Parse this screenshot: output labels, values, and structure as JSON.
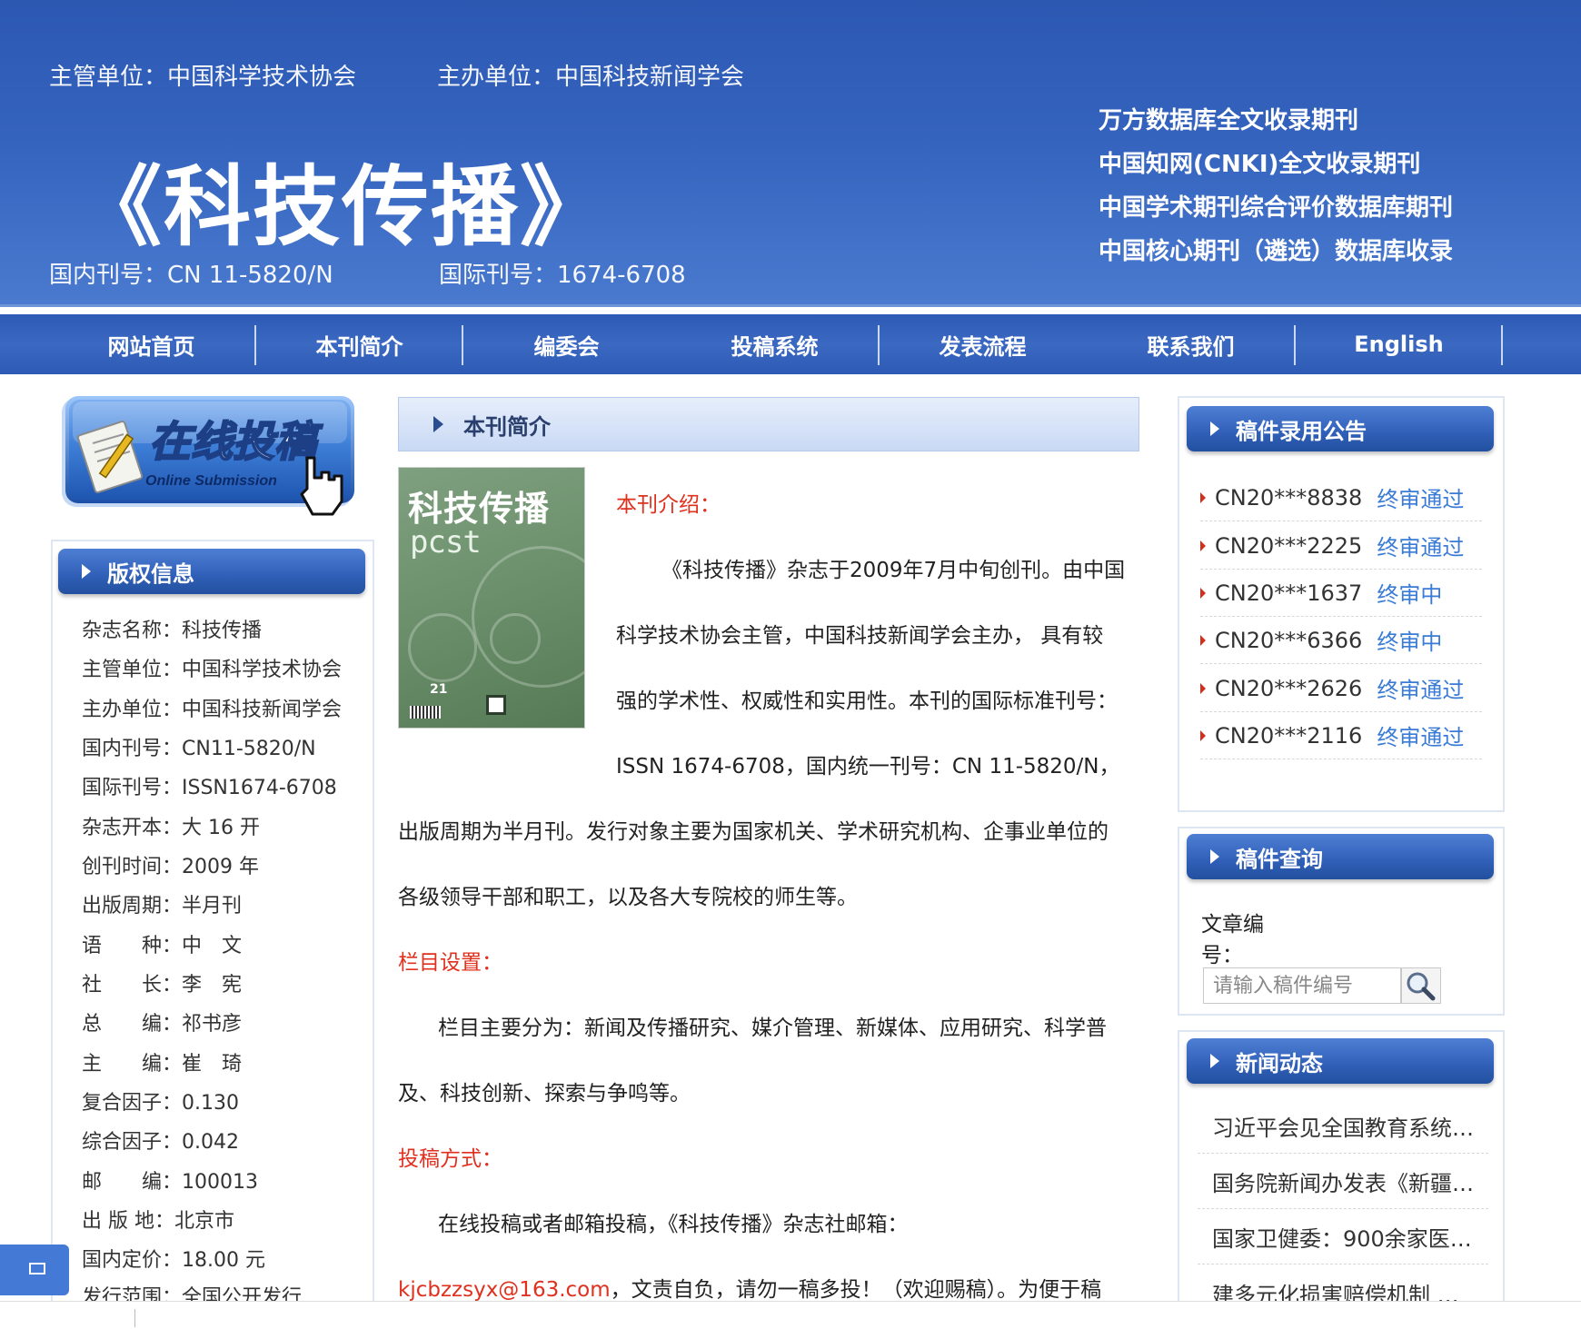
{
  "header": {
    "supervisor": "主管单位：中国科学技术协会",
    "sponsor": "主办单位：中国科技新闻学会",
    "title": "《科技传播》",
    "cn_number": "国内刊号：CN 11-5820/N",
    "issn_number": "国际刊号：1674-6708",
    "indexing": [
      "万方数据库全文收录期刊",
      "中国知网(CNKI)全文收录期刊",
      "中国学术期刊综合评价数据库期刊",
      "中国核心期刊（遴选）数据库收录"
    ]
  },
  "nav": [
    "网站首页",
    "本刊简介",
    "编委会",
    "投稿系统",
    "发表流程",
    "联系我们",
    "English"
  ],
  "submit_banner": {
    "text": "在线投稿",
    "subtext": "Online Submission"
  },
  "copyright": {
    "heading": "版权信息",
    "rows": [
      "杂志名称：科技传播",
      "主管单位：中国科学技术协会",
      "主办单位：中国科技新闻学会",
      "国内刊号：CN11-5820/N",
      "国际刊号：ISSN1674-6708",
      "杂志开本：大 16 开",
      "创刊时间：2009 年",
      "出版周期：半月刊",
      "语　　种：中　文",
      "社　　长：李　宪",
      "总　　编：祁书彦",
      "主　　编：崔　琦",
      "复合因子：0.130",
      "综合因子：0.042",
      "邮　　编：100013",
      "出 版 地：北京市",
      "国内定价：18.00 元",
      "发行范围：全国公开发行"
    ]
  },
  "main": {
    "heading": "本刊简介",
    "cover": {
      "title": "科技传播",
      "subtitle": "pcst",
      "issue": "21"
    },
    "intro_label": "本刊介绍：",
    "intro_lines": [
      "《科技传播》杂志于2009年7月中旬创刊。由中国",
      "科学技术协会主管，中国科技新闻学会主办，  具有较",
      "强的学术性、权威性和实用性。本刊的国际标准刊号：",
      "ISSN 1674-6708，国内统一刊号：CN 11-5820/N，",
      "出版周期为半月刊。发行对象主要为国家机关、学术研究机构、企事业单位的",
      "各级领导干部和职工，以及各大专院校的师生等。"
    ],
    "columns_label": "栏目设置：",
    "columns_lines": [
      "栏目主要分为：新闻及传播研究、媒介管理、新媒体、应用研究、科学普",
      "及、科技创新、探索与争鸣等。"
    ],
    "submission_label": "投稿方式：",
    "submission_line1": "在线投稿或者邮箱投稿，《科技传播》杂志社邮箱：",
    "email": "kjcbzzsyx@163.com",
    "submission_line2_rest": "，文责自负，请勿一稿多投！（欢迎赐稿）。为便于稿"
  },
  "notices": {
    "heading": "稿件录用公告",
    "items": [
      {
        "code": "CN20***8838",
        "status": "终审通过"
      },
      {
        "code": "CN20***2225",
        "status": "终审通过"
      },
      {
        "code": "CN20***1637",
        "status": "终审中"
      },
      {
        "code": "CN20***6366",
        "status": "终审中"
      },
      {
        "code": "CN20***2626",
        "status": "终审通过"
      },
      {
        "code": "CN20***2116",
        "status": "终审通过"
      }
    ]
  },
  "query": {
    "heading": "稿件查询",
    "label_line1": "文章编",
    "label_line2": "号：",
    "placeholder": "请输入稿件编号"
  },
  "news": {
    "heading": "新闻动态",
    "items": [
      "习近平会见全国教育系统…",
      "国务院新闻办发表《新疆…",
      "国家卫健委：900余家医…",
      "建多元化损害赔偿机制 …"
    ]
  },
  "colors": {
    "header_blue": "#3463be",
    "link_blue": "#3a7bd5",
    "label_red": "#e0301e"
  }
}
